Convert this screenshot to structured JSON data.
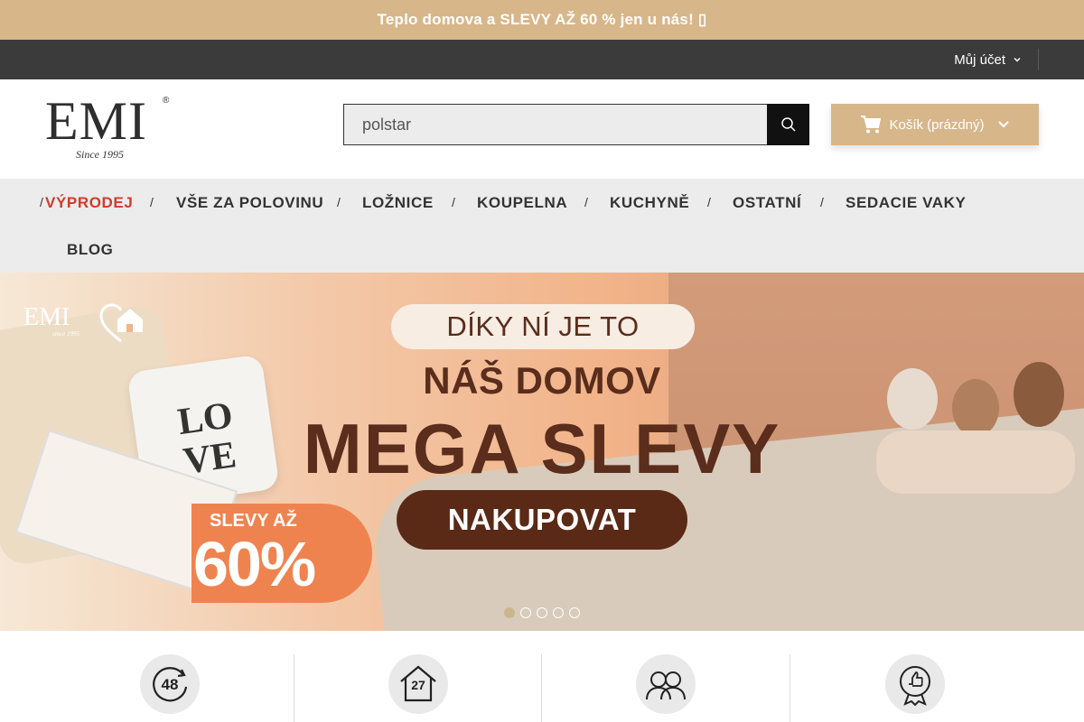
{
  "promo": {
    "text": "Teplo domova a SLEVY AŽ 60 % jen u nás! ▯"
  },
  "account": {
    "label": "Můj účet"
  },
  "header": {
    "logo": {
      "text": "EMI",
      "reg": "®",
      "since": "Since 1995"
    },
    "search": {
      "value": "polstar",
      "placeholder": "polstar"
    },
    "cart": {
      "label": "Košík (prázdný)"
    }
  },
  "nav": {
    "items": [
      {
        "label": "VÝPRODEJ"
      },
      {
        "label": "VŠE ZA POLOVINU"
      },
      {
        "label": "LOŽNICE"
      },
      {
        "label": "KOUPELNA"
      },
      {
        "label": "KUCHYNĚ"
      },
      {
        "label": "OSTATNÍ"
      },
      {
        "label": "SEDACIE VAKY"
      },
      {
        "label": "BLOG"
      }
    ],
    "separator": "/"
  },
  "hero": {
    "brand": "EMI",
    "brand_since": "since 1995",
    "pillow_text": "LO\nVE",
    "pill_top": "DÍKY NÍ JE TO",
    "headline_1": "NÁŠ DOMOV",
    "headline_2": "MEGA SLEVY",
    "cta": "NAKUPOVAT",
    "discount_label": "SLEVY AŽ",
    "discount_value": "60%",
    "slides_total": 5,
    "slide_active": 1
  },
  "features": [
    {
      "icon": "48-hours-icon",
      "text": "48"
    },
    {
      "icon": "house-27-icon",
      "text": "27"
    },
    {
      "icon": "customers-icon"
    },
    {
      "icon": "quality-badge-icon"
    }
  ],
  "colors": {
    "accent": "#d7b68a",
    "dark": "#3b3b3b",
    "sale": "#d23b2a",
    "hero_brown": "#5a2d1c"
  }
}
